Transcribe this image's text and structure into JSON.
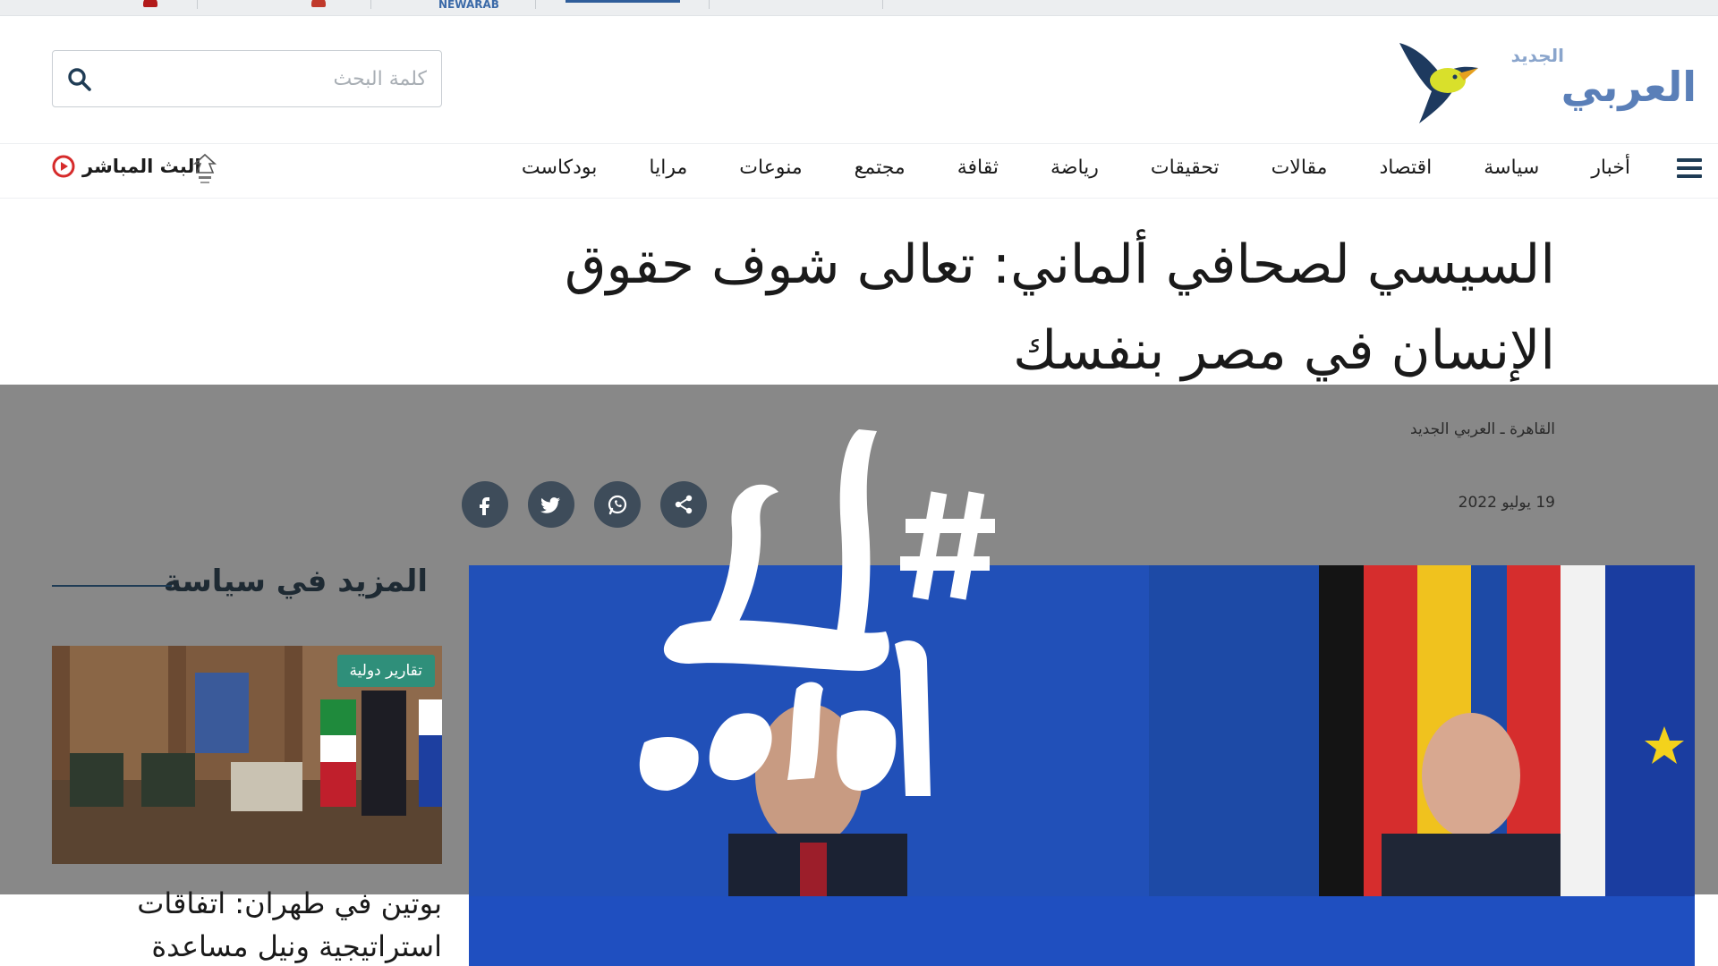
{
  "topstrip": {
    "partner_label": "NEWARAB"
  },
  "search": {
    "placeholder": "كلمة البحث"
  },
  "brand": {
    "name": "العربي",
    "sub": "الجديد"
  },
  "nav": {
    "items": [
      "أخبار",
      "سياسة",
      "اقتصاد",
      "مقالات",
      "تحقيقات",
      "رياضة",
      "ثقافة",
      "مجتمع",
      "منوعات",
      "مرايا",
      "بودكاست"
    ],
    "live_label": "البث المباشر"
  },
  "article": {
    "headline": "السيسي لصحافي ألماني: تعالى شوف حقوق الإنسان في مصر بنفسك",
    "location": "القاهرة ـ العربي الجديد",
    "date": "19 يوليو 2022"
  },
  "share": {
    "icons": [
      "facebook-icon",
      "twitter-icon",
      "whatsapp-icon",
      "share-icon"
    ]
  },
  "sidebar": {
    "section_title": "المزيد في سياسة",
    "card": {
      "badge": "تقارير دولية",
      "title": "بوتين في طهران: اتفاقات استراتيجية ونيل مساعدة"
    }
  },
  "overlay": {
    "hashtag_text": "# ليتها الحدود"
  },
  "colors": {
    "nav_dark": "#1f3c55",
    "badge_green": "#2f8f7a",
    "brand_blue": "#5a7fb8",
    "live_red": "#d62b2b",
    "overlay_grey": "#6e6e6e"
  }
}
